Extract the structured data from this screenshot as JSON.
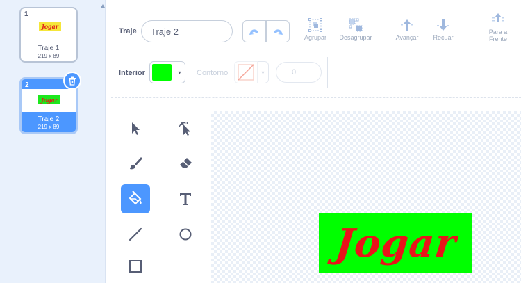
{
  "costumes": [
    {
      "index": "1",
      "thumb_text": "Jogar",
      "name": "Traje 1",
      "size": "219 x 89"
    },
    {
      "index": "2",
      "thumb_text": "Jogar",
      "name": "Traje 2",
      "size": "219 x 89"
    }
  ],
  "toolbar": {
    "costume_label": "Traje",
    "costume_name": "Traje 2",
    "group_label": "Agrupar",
    "ungroup_label": "Desagrupar",
    "forward_label": "Avançar",
    "backward_label": "Recuar",
    "front_label_1": "Para a",
    "front_label_2": "Frente",
    "fill_label": "Interior",
    "outline_label": "Contorno",
    "outline_width": "0"
  },
  "colors": {
    "accent": "#4c97ff",
    "fill_color": "#00ff00",
    "text_color": "#575e75"
  },
  "canvas": {
    "text": "Jogar"
  },
  "icons": [
    "select-icon",
    "reshape-icon",
    "brush-icon",
    "eraser-icon",
    "fill-icon",
    "text-icon",
    "line-icon",
    "circle-icon",
    "rectangle-icon",
    "undo-icon",
    "redo-icon",
    "group-icon",
    "ungroup-icon",
    "forward-icon",
    "backward-icon",
    "front-icon",
    "trash-icon"
  ]
}
